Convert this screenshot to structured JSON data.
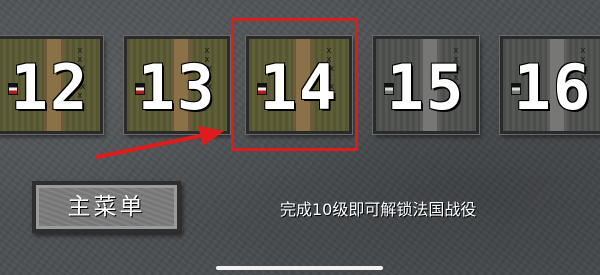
{
  "levels": [
    {
      "number": "12",
      "state": "unlocked"
    },
    {
      "number": "13",
      "state": "unlocked"
    },
    {
      "number": "14",
      "state": "unlocked"
    },
    {
      "number": "15",
      "state": "locked"
    },
    {
      "number": "16",
      "state": "locked"
    }
  ],
  "menu_button": {
    "label": "主菜单"
  },
  "unlock_hint": "完成10级即可解锁法国战役",
  "colors": {
    "selection": "#e01b1b",
    "arrow": "#e01b1b",
    "background": "#4d5154"
  }
}
